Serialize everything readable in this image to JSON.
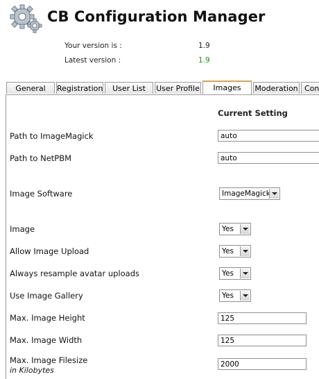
{
  "header": {
    "title": "CB Configuration Manager",
    "logo_icon": "gears-icon"
  },
  "version": {
    "your_label": "Your version is :",
    "your_value": "1.9",
    "latest_label": "Latest version :",
    "latest_value": "1.9",
    "latest_color": "#2a8a2a"
  },
  "tabs": [
    {
      "label": "General",
      "active": false
    },
    {
      "label": "Registration",
      "active": false
    },
    {
      "label": "User List",
      "active": false
    },
    {
      "label": "User Profile",
      "active": false
    },
    {
      "label": "Images",
      "active": true
    },
    {
      "label": "Moderation",
      "active": false
    },
    {
      "label": "Connections",
      "active": false
    }
  ],
  "accent_color": "#f0a020",
  "panel": {
    "column_header": "Current Setting",
    "rows": {
      "imagemagick_path": {
        "label": "Path to ImageMagick",
        "value": "auto"
      },
      "netpbm_path": {
        "label": "Path to NetPBM",
        "value": "auto"
      },
      "image_software": {
        "label": "Image Software",
        "value": "ImageMagick"
      },
      "image": {
        "label": "Image",
        "value": "Yes"
      },
      "allow_upload": {
        "label": "Allow Image Upload",
        "value": "Yes"
      },
      "resample": {
        "label": "Always resample avatar uploads",
        "value": "Yes"
      },
      "gallery": {
        "label": "Use Image Gallery",
        "value": "Yes"
      },
      "max_height": {
        "label": "Max. Image Height",
        "value": "125"
      },
      "max_width": {
        "label": "Max. Image Width",
        "value": "125"
      },
      "max_filesize": {
        "label": "Max. Image Filesize",
        "sublabel": "in Kilobytes",
        "value": "2000"
      }
    }
  }
}
